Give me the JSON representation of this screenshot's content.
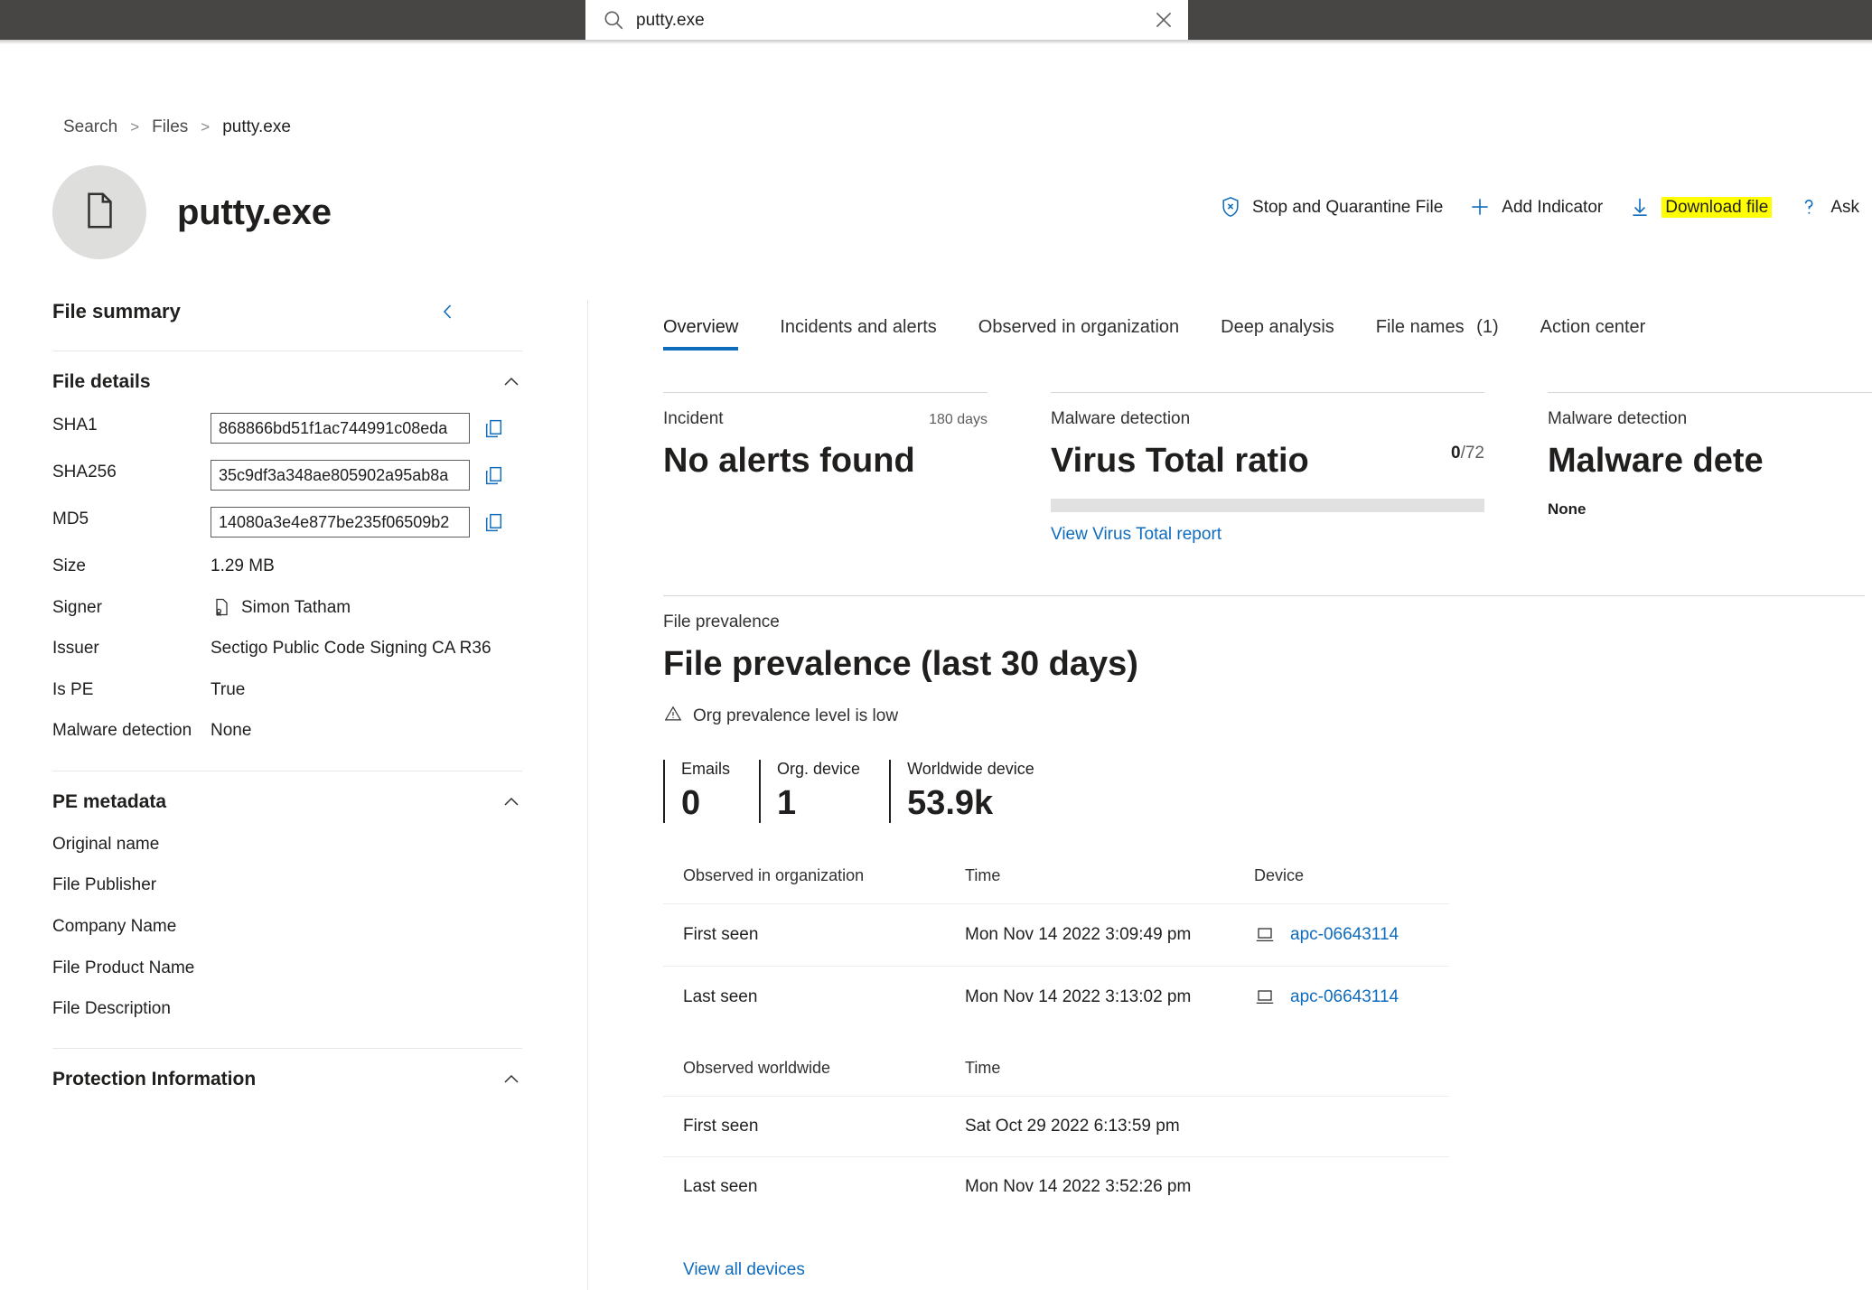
{
  "search": {
    "value": "putty.exe",
    "placeholder": "Search",
    "icon": "search-icon",
    "clear_icon": "close-icon"
  },
  "breadcrumb": {
    "items": [
      "Search",
      "Files",
      "putty.exe"
    ],
    "separator": ">"
  },
  "header": {
    "title": "putty.exe",
    "avatar_icon": "file-icon"
  },
  "commands": [
    {
      "label": "Stop and Quarantine File",
      "icon": "shield-x-icon",
      "highlight": false
    },
    {
      "label": "Add Indicator",
      "icon": "plus-icon",
      "highlight": false
    },
    {
      "label": "Download file",
      "icon": "download-icon",
      "highlight": true
    },
    {
      "label": "Ask",
      "icon": "question-icon",
      "highlight": false
    }
  ],
  "sidebar": {
    "title": "File summary",
    "collapse_icon": "chevron-left-icon",
    "file_details": {
      "title": "File details",
      "chevron": "chevron-up-icon",
      "hashes": [
        {
          "label": "SHA1",
          "value": "868866bd51f1ac744991c08eda",
          "copy_icon": "copy-icon"
        },
        {
          "label": "SHA256",
          "value": "35c9df3a348ae805902a95ab8a",
          "copy_icon": "copy-icon"
        },
        {
          "label": "MD5",
          "value": "14080a3e4e877be235f06509b2",
          "copy_icon": "copy-icon"
        }
      ],
      "size_label": "Size",
      "size_value": "1.29 MB",
      "signer_label": "Signer",
      "signer_value": "Simon Tatham",
      "signer_icon": "certificate-icon",
      "issuer_label": "Issuer",
      "issuer_value": "Sectigo Public Code Signing CA R36",
      "ispe_label": "Is PE",
      "ispe_value": "True",
      "malware_label": "Malware detection",
      "malware_value": "None"
    },
    "pe_metadata": {
      "title": "PE metadata",
      "chevron": "chevron-up-icon",
      "fields": [
        "Original name",
        "File Publisher",
        "Company Name",
        "File Product Name",
        "File Description"
      ]
    },
    "protection": {
      "title": "Protection Information",
      "chevron": "chevron-up-icon"
    }
  },
  "main": {
    "tabs": [
      {
        "label": "Overview",
        "count": "",
        "active": true
      },
      {
        "label": "Incidents and alerts",
        "count": "",
        "active": false
      },
      {
        "label": "Observed in organization",
        "count": "",
        "active": false
      },
      {
        "label": "Deep analysis",
        "count": "",
        "active": false
      },
      {
        "label": "File names",
        "count": "(1)",
        "active": false
      },
      {
        "label": "Action center",
        "count": "",
        "active": false
      }
    ],
    "cards": {
      "incident": {
        "eyebrow": "Incident",
        "meta": "180 days",
        "big": "No alerts found"
      },
      "virustotal": {
        "eyebrow": "Malware detection",
        "big": "Virus Total ratio",
        "ratio_numerator": "0",
        "ratio_denominator": "/72",
        "link": "View Virus Total report"
      },
      "malware": {
        "eyebrow": "Malware detection",
        "big": "Malware dete",
        "value": "None"
      }
    },
    "prevalence": {
      "eyebrow": "File prevalence",
      "title": "File prevalence (last 30 days)",
      "warning": "Org prevalence level is low",
      "warning_icon": "warning-triangle-icon",
      "stats": [
        {
          "label": "Emails",
          "value": "0"
        },
        {
          "label": "Org. device",
          "value": "1"
        },
        {
          "label": "Worldwide device",
          "value": "53.9k"
        }
      ]
    },
    "org_table": {
      "headers": [
        "Observed in organization",
        "Time",
        "Device"
      ],
      "rows": [
        {
          "event": "First seen",
          "time": "Mon Nov 14 2022 3:09:49 pm",
          "device": "apc-06643114",
          "device_icon": "device-icon"
        },
        {
          "event": "Last seen",
          "time": "Mon Nov 14 2022 3:13:02 pm",
          "device": "apc-06643114",
          "device_icon": "device-icon"
        }
      ]
    },
    "worldwide_table": {
      "headers": [
        "Observed worldwide",
        "Time"
      ],
      "rows": [
        {
          "event": "First seen",
          "time": "Sat Oct 29 2022 6:13:59 pm"
        },
        {
          "event": "Last seen",
          "time": "Mon Nov 14 2022 3:52:26 pm"
        }
      ]
    },
    "view_all_devices": "View all devices"
  },
  "colors": {
    "accent": "#0f6cbd",
    "header_bg": "#484644",
    "highlight": "#ffff00",
    "text": "#201f1e"
  }
}
